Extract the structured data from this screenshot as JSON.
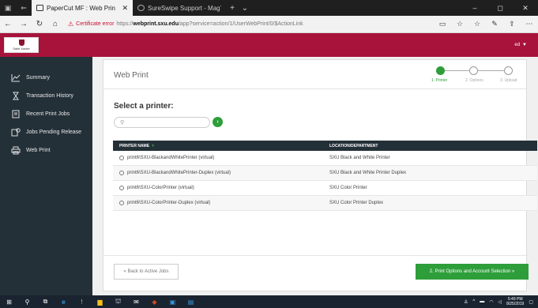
{
  "browser": {
    "tabs": [
      {
        "title": "PaperCut MF : Web Prin",
        "active": true
      },
      {
        "title": "SureSwipe Support - MagTe",
        "active": false
      }
    ],
    "address": {
      "cert_error": "Certificate error",
      "protocol": "https://",
      "host": "webprint.sxu.edu",
      "path": "/app?service=action/1/UserWebPrint/0/$ActionLink"
    },
    "window_controls": {
      "minimize": "–",
      "maximize": "◻",
      "close": "✕"
    }
  },
  "header": {
    "logo_text": "Saint Xavier",
    "user_label": "ed",
    "accent_color": "#a7133a"
  },
  "sidebar": {
    "items": [
      {
        "label": "Summary",
        "icon": "chart-icon"
      },
      {
        "label": "Transaction History",
        "icon": "hourglass-icon"
      },
      {
        "label": "Recent Print Jobs",
        "icon": "document-icon"
      },
      {
        "label": "Jobs Pending Release",
        "icon": "pending-icon"
      },
      {
        "label": "Web Print",
        "icon": "printer-icon"
      }
    ]
  },
  "main": {
    "title": "Web Print",
    "steps": [
      {
        "label": "1. Printer",
        "active": true
      },
      {
        "label": "2. Options",
        "active": false
      },
      {
        "label": "3. Upload",
        "active": false
      }
    ],
    "section_title": "Select a printer:",
    "search": {
      "value": "",
      "placeholder": ""
    },
    "table": {
      "col_name": "PRINTER NAME",
      "col_location": "LOCATION/DEPARTMENT",
      "rows": [
        {
          "name": "print6\\SXU-BlackandWhitePrinter (virtual)",
          "location": "SXU Black and White Printer"
        },
        {
          "name": "print6\\SXU-BlackandWhitePrinter-Duplex (virtual)",
          "location": "SXU Black and White Printer Duplex"
        },
        {
          "name": "print6\\SXU-ColorPrinter (virtual)",
          "location": "SXU Color Printer"
        },
        {
          "name": "print6\\SXU-ColorPrinter-Duplex (virtual)",
          "location": "SXU Color Printer Duplex"
        }
      ]
    },
    "back_button": "« Back to Active Jobs",
    "next_button": "2. Print Options and Account Selection »",
    "success_color": "#2e9e3a"
  },
  "taskbar": {
    "time": "5:49 PM",
    "date": "8/25/2019"
  }
}
